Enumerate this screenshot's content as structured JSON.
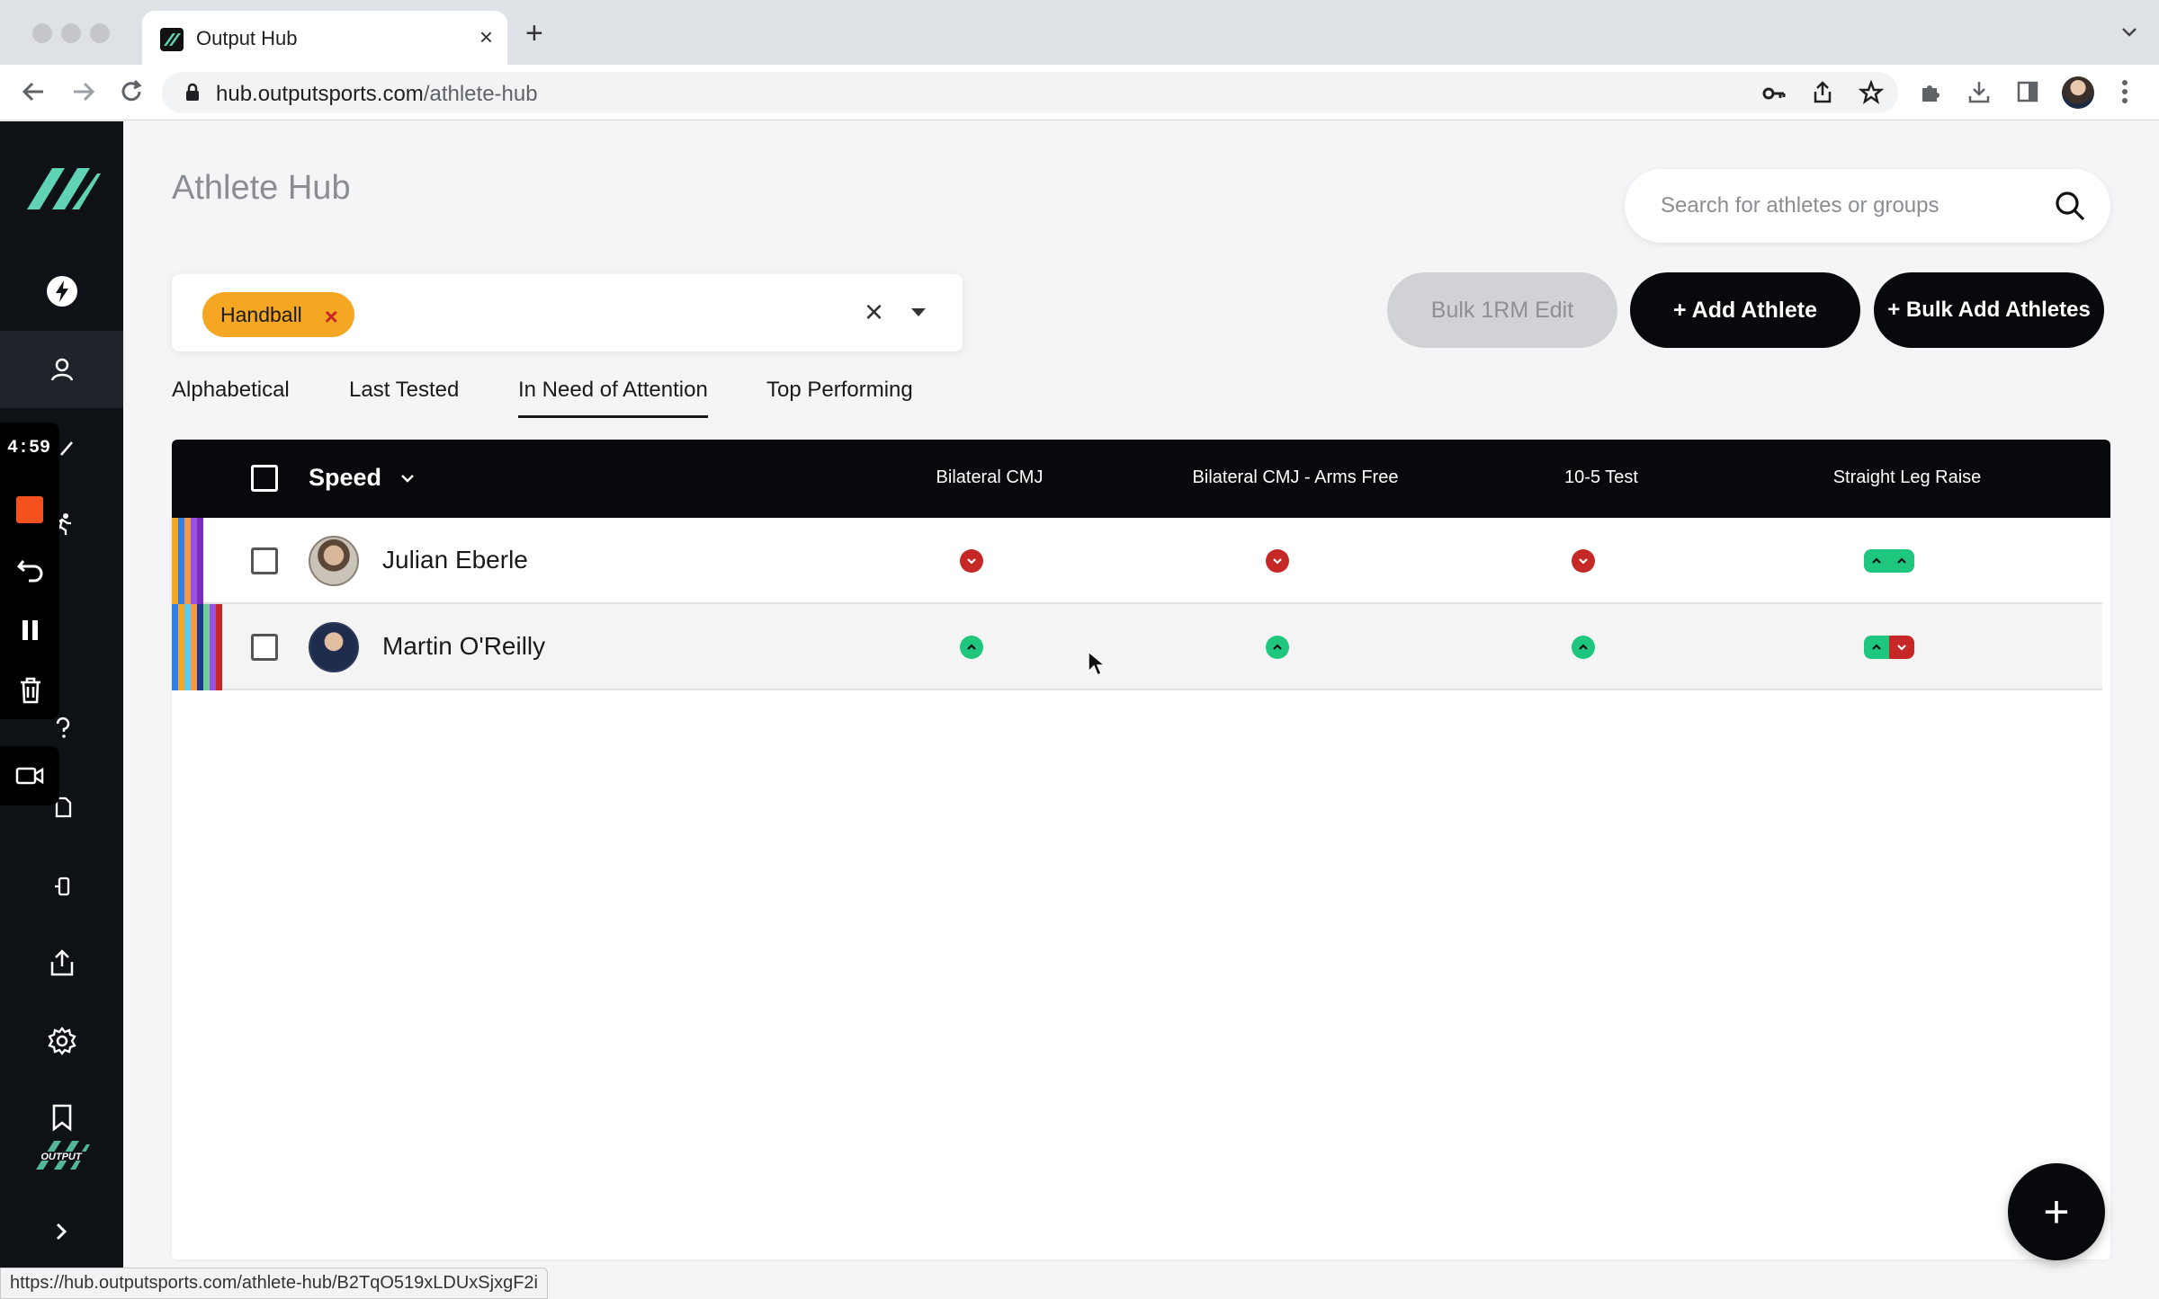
{
  "browser": {
    "tab_title": "Output Hub",
    "url_host": "hub.outputsports.com",
    "url_path": "/athlete-hub",
    "status_url": "https://hub.outputsports.com/athlete-hub/B2TqO519xLDUxSjxgF2i"
  },
  "recorder": {
    "time": "4:59"
  },
  "sidebar": {
    "items": [
      "bolt-icon",
      "athlete-icon",
      "run-icon",
      "question-icon",
      "document-icon",
      "device-icon",
      "upload-icon",
      "gear-icon",
      "bookmark-icon"
    ],
    "active": "athlete-icon"
  },
  "header": {
    "title": "Athlete Hub",
    "search_placeholder": "Search for athletes or groups"
  },
  "filter": {
    "chips": [
      "Handball"
    ]
  },
  "buttons": {
    "bulk_1rm_edit": "Bulk 1RM Edit",
    "add_athlete": "+ Add Athlete",
    "bulk_add_athletes": "+ Bulk Add Athletes"
  },
  "sort_tabs": [
    {
      "label": "Alphabetical",
      "active": false
    },
    {
      "label": "Last Tested",
      "active": false
    },
    {
      "label": "In Need of Attention",
      "active": true
    },
    {
      "label": "Top Performing",
      "active": false
    }
  ],
  "table": {
    "category": "Speed",
    "columns": [
      "Bilateral CMJ",
      "Bilateral CMJ - Arms Free",
      "10-5 Test",
      "Straight Leg Raise"
    ],
    "rows": [
      {
        "name": "Julian Eberle",
        "stripes": [
          "#f5a623",
          "#2f80ed",
          "#f2994a",
          "#9b51e0",
          "#7b2cbf"
        ],
        "indicators": [
          [
            "down"
          ],
          [
            "down"
          ],
          [
            "down"
          ],
          [
            "up",
            "up"
          ]
        ]
      },
      {
        "name": "Martin O'Reilly",
        "stripes": [
          "#2f80ed",
          "#f5a623",
          "#56ccf2",
          "#f2994a",
          "#1e3a8a",
          "#6fcf97",
          "#9b51e0",
          "#c62828"
        ],
        "indicators": [
          [
            "up"
          ],
          [
            "up"
          ],
          [
            "up"
          ],
          [
            "up",
            "down"
          ]
        ]
      }
    ]
  },
  "colors": {
    "accent_green": "#1fc77e",
    "alert_red": "#c62828",
    "chip_orange": "#f5a623",
    "brand_teal": "#5fd3b3",
    "header_black": "#07090d"
  }
}
